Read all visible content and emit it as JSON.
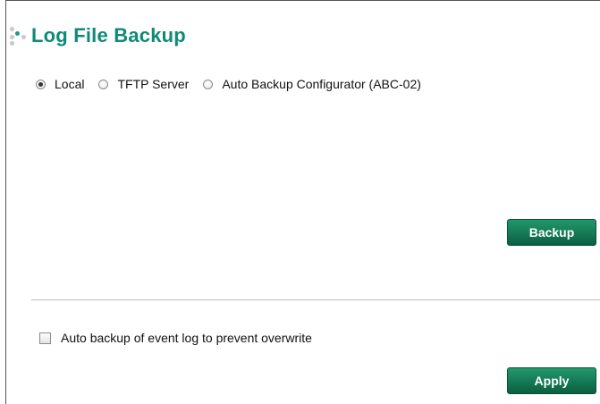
{
  "page": {
    "title": "Log File Backup",
    "title_color": "#0f8a76"
  },
  "backup_target": {
    "options": [
      {
        "label": "Local",
        "checked": true
      },
      {
        "label": "TFTP Server",
        "checked": false
      },
      {
        "label": "Auto Backup Configurator (ABC-02)",
        "checked": false
      }
    ]
  },
  "actions": {
    "backup_label": "Backup",
    "apply_label": "Apply",
    "button_color": "#15744f"
  },
  "options": {
    "auto_backup_label": "Auto backup of event log to prevent overwrite",
    "auto_backup_checked": false
  },
  "icons": {
    "title_icon": "dots-bullet-icon"
  }
}
